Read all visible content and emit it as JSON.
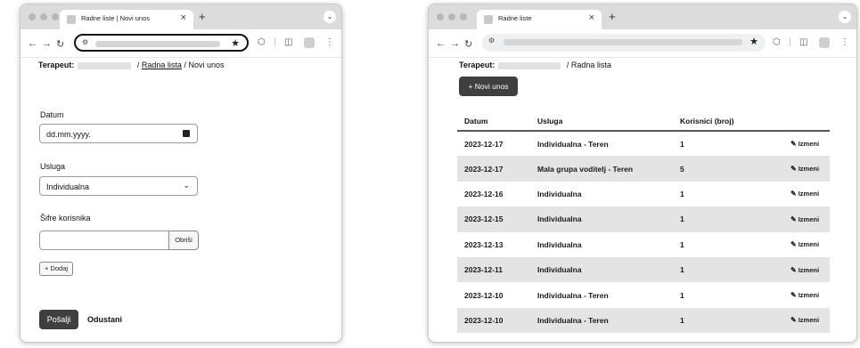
{
  "left_window": {
    "tab_title": "Radne liste | Novi unos",
    "breadcrumb": {
      "label": "Terapeut:",
      "link": "Radna lista",
      "sep": "/",
      "current": "Novi unos"
    },
    "form": {
      "date_label": "Datum",
      "date_value": "dd.mm.yyyy.",
      "service_label": "Usluga",
      "service_value": "Individualna",
      "codes_label": "Šifre korisnika",
      "codes_value": "",
      "remove_label": "Obriši",
      "add_label": "+ Dodaj",
      "submit_label": "Pošalji",
      "cancel_label": "Odustani"
    }
  },
  "right_window": {
    "tab_title": "Radne liste",
    "breadcrumb": {
      "label": "Terapeut:",
      "sep": "/",
      "current": "Radna lista"
    },
    "new_entry_label": "+ Novi unos",
    "table": {
      "headers": [
        "Datum",
        "Usluga",
        "Korisnici (broj)",
        ""
      ],
      "edit_label": "Izmeni",
      "rows": [
        {
          "date": "2023-12-17",
          "service": "Individualna - Teren",
          "count": "1"
        },
        {
          "date": "2023-12-17",
          "service": "Mala grupa voditelj - Teren",
          "count": "5"
        },
        {
          "date": "2023-12-16",
          "service": "Individualna",
          "count": "1"
        },
        {
          "date": "2023-12-15",
          "service": "Individualna",
          "count": "1"
        },
        {
          "date": "2023-12-13",
          "service": "Individualna",
          "count": "1"
        },
        {
          "date": "2023-12-11",
          "service": "Individualna",
          "count": "1"
        },
        {
          "date": "2023-12-10",
          "service": "Individualna - Teren",
          "count": "1"
        },
        {
          "date": "2023-12-10",
          "service": "Individualna - Teren",
          "count": "1"
        }
      ]
    }
  },
  "icons": {
    "tab_close": "close-icon",
    "new_tab": "plus-icon",
    "bookmark": "star-icon",
    "calendar": "calendar-icon",
    "dropdown": "chevron-down-icon",
    "edit": "pencil-icon"
  }
}
